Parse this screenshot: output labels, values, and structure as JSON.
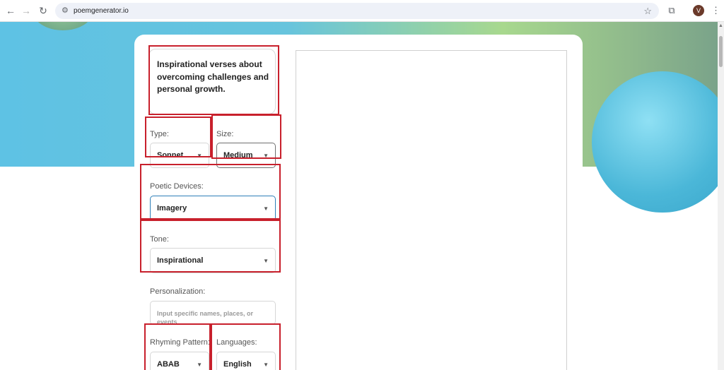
{
  "browser": {
    "url": "poemgenerator.io",
    "avatar_initial": "V"
  },
  "form": {
    "prompt_text": "Inspirational verses about overcoming challenges and personal growth.",
    "type": {
      "label": "Type:",
      "value": "Sonnet"
    },
    "size": {
      "label": "Size:",
      "value": "Medium"
    },
    "poetic_devices": {
      "label": "Poetic Devices:",
      "value": "Imagery"
    },
    "tone": {
      "label": "Tone:",
      "value": "Inspirational"
    },
    "personalization": {
      "label": "Personalization:",
      "placeholder": "Input specific names, places, or events"
    },
    "rhyming_pattern": {
      "label": "Rhyming Pattern:",
      "value": "ABAB"
    },
    "languages": {
      "label": "Languages:",
      "value": "English"
    }
  },
  "colors": {
    "highlight": "#c8202c",
    "focus_border": "#2e7fb8"
  }
}
